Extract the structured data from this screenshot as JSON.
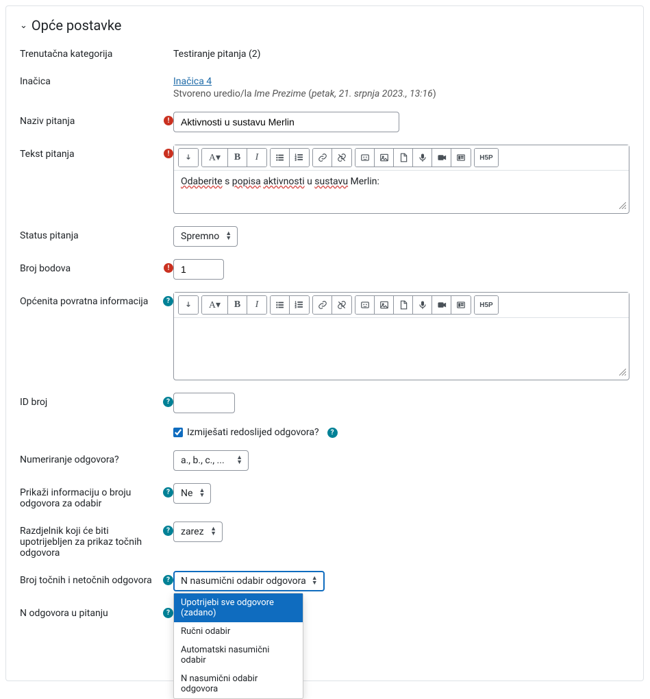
{
  "section_title": "Opće postavke",
  "labels": {
    "current_category": "Trenutačna kategorija",
    "version": "Inačica",
    "question_name": "Naziv pitanja",
    "question_text": "Tekst pitanja",
    "question_status": "Status pitanja",
    "default_mark": "Broj bodova",
    "general_feedback": "Općenita povratna informacija",
    "id_number": "ID broj",
    "shuffle": "Izmiješati redoslijed odgovora?",
    "numbering": "Numeriranje odgovora?",
    "show_num_correct": "Prikaži informaciju o broju odgovora za odabir",
    "separator": "Razdjelnik koji će biti upotrijebljen za prikaz točnih odgovora",
    "num_correct_incorrect": "Broj točnih i netočnih odgovora",
    "n_answers": "N odgovora u pitanju"
  },
  "values": {
    "current_category": "Testiranje pitanja (2)",
    "version_link": "Inačica 4",
    "version_meta_1": "Stvoreno uredio/la ",
    "version_meta_author": "Ime Prezime",
    "version_meta_2": " (",
    "version_meta_date": "petak, 21. srpnja 2023., 13:16",
    "version_meta_3": ")",
    "question_name": "Aktivnosti u sustavu Merlin",
    "question_text_parts": {
      "p1": "Odaberite",
      "p2": " s ",
      "p3": "popisa",
      "p4": " ",
      "p5": "aktivnosti",
      "p6": " u ",
      "p7": "sustavu",
      "p8": " Merlin:"
    },
    "status": "Spremno",
    "default_mark": "1",
    "shuffle_checked": true,
    "numbering": "a., b., c., ...",
    "show_num_correct": "Ne",
    "separator": "zarez",
    "num_correct_incorrect": "N nasumični odabir odgovora"
  },
  "dropdown_options": [
    "Upotrijebi sve odgovore (zadano)",
    "Ručni odabir",
    "Automatski nasumični odabir",
    "N nasumični odabir odgovora"
  ],
  "icons": {
    "help": "?",
    "required": "!"
  }
}
